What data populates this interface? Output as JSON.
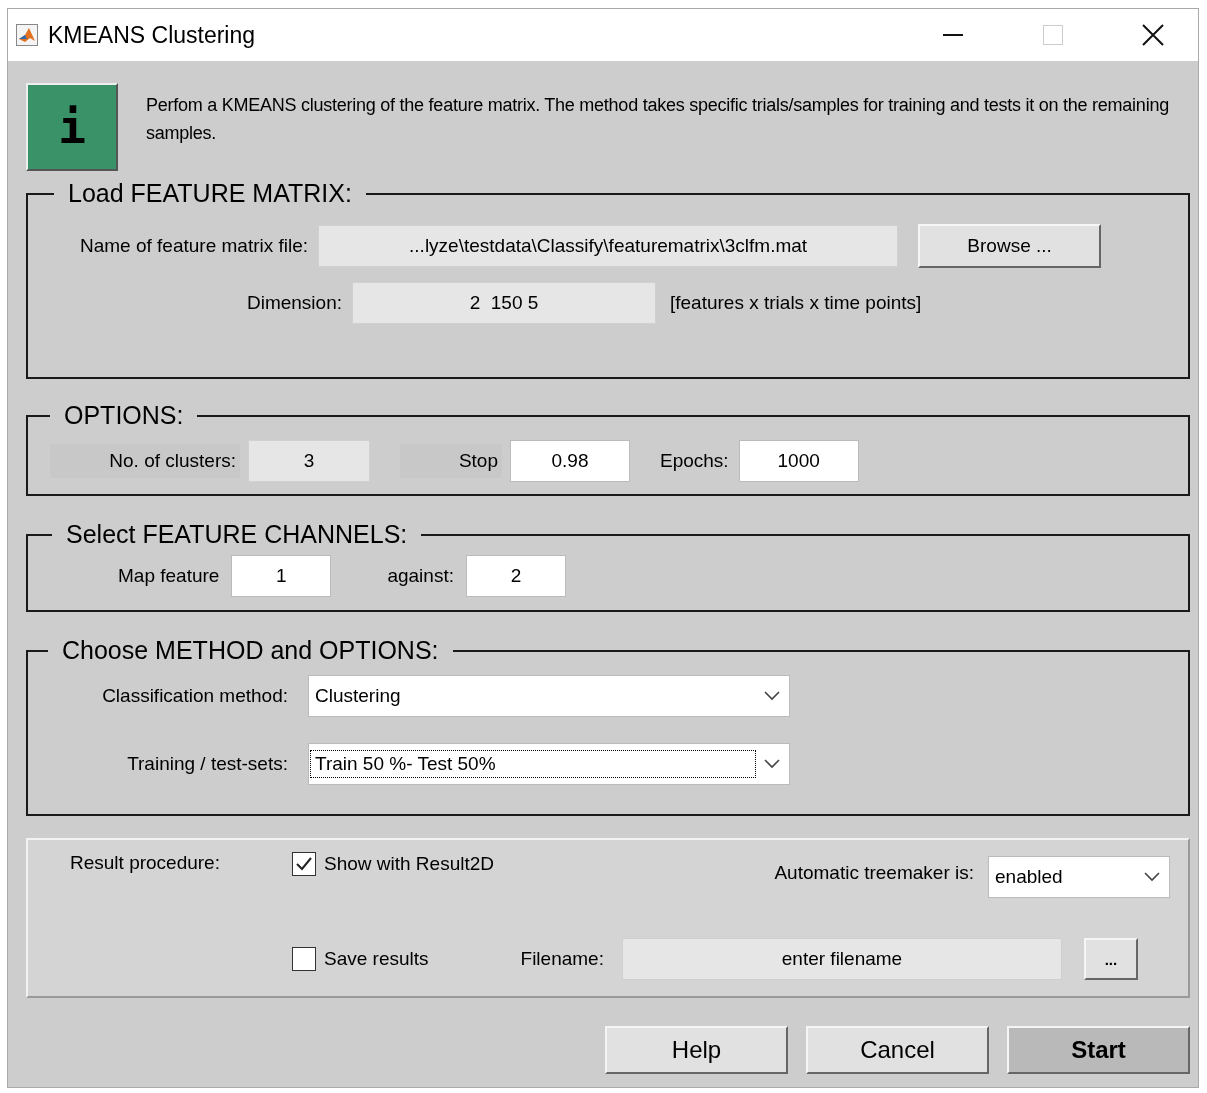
{
  "window": {
    "title": "KMEANS Clustering"
  },
  "info": {
    "icon_text": "i",
    "text": "Perfom a KMEANS clustering of the feature matrix. The method takes specific trials/samples for training and tests it on the remaining samples."
  },
  "load_panel": {
    "title": "Load FEATURE MATRIX:",
    "file_label": "Name of feature matrix file:",
    "file_value": "...lyze\\testdata\\Classify\\featurematrix\\3clfm.mat",
    "file_disabled": true,
    "browse_button": "Browse ...",
    "dimension_label": "Dimension:",
    "dimension_value": "2  150 5",
    "dimension_disabled": true,
    "dimension_hint": "[features x trials x time points]"
  },
  "options_panel": {
    "title": "OPTIONS:",
    "fields": [
      {
        "label": "No. of clusters:",
        "value": "3",
        "disabled": true
      },
      {
        "label": "Stop",
        "value": "0.98",
        "disabled": false
      },
      {
        "label": "Epochs:",
        "value": "1000",
        "disabled": false
      }
    ]
  },
  "channels_panel": {
    "title": "Select FEATURE CHANNELS:",
    "fields": [
      {
        "label": "Map feature",
        "value": "1",
        "disabled": false
      },
      {
        "label": "against:",
        "value": "2",
        "disabled": false
      }
    ]
  },
  "method_panel": {
    "title": "Choose METHOD and OPTIONS:",
    "selects": [
      {
        "label": "Classification method:",
        "value": "Clustering",
        "focused": false
      },
      {
        "label": "Training / test-sets:",
        "value": "Train 50 %- Test 50%",
        "focused": true
      }
    ]
  },
  "result_panel": {
    "label": "Result procedure:",
    "show_checkbox": {
      "label": "Show with Result2D",
      "checked": true
    },
    "treemaker_label": "Automatic treemaker is:",
    "treemaker_value": "enabled",
    "save_checkbox": {
      "label": "Save results",
      "checked": false
    },
    "filename_label": "Filename:",
    "filename_value": "enter filename",
    "filename_disabled": true,
    "dots_button": "..."
  },
  "buttons": [
    {
      "label": "Help",
      "kind": "normal"
    },
    {
      "label": "Cancel",
      "kind": "normal"
    },
    {
      "label": "Start",
      "kind": "default"
    }
  ]
}
